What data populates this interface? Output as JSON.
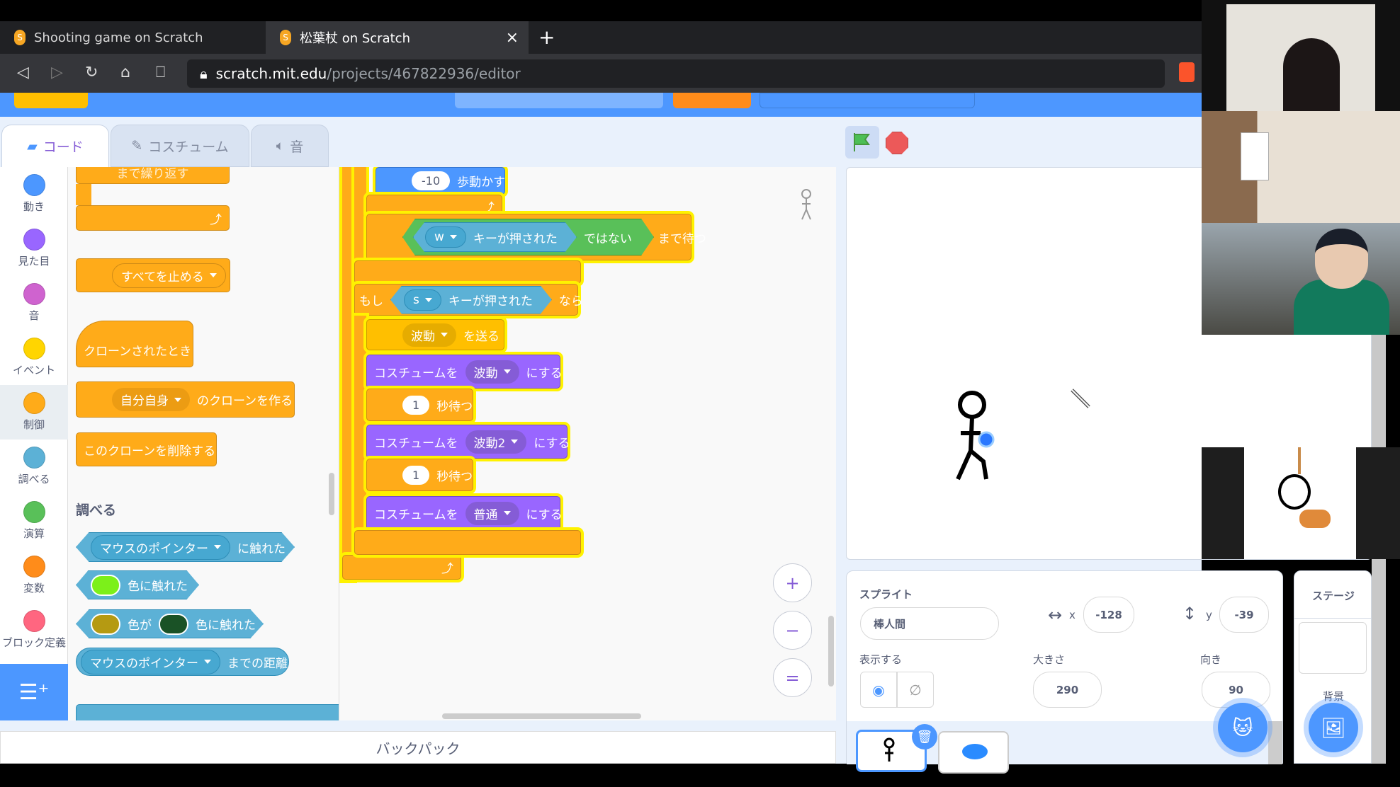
{
  "browser": {
    "tabs": [
      {
        "title": "Shooting game on Scratch",
        "active": false
      },
      {
        "title": "松葉杖 on Scratch",
        "active": true
      }
    ],
    "close_icon": "×",
    "new_tab_icon": "+",
    "url_host": "scratch.mit.edu",
    "url_path": "/projects/467822936/editor"
  },
  "editor": {
    "tabs": [
      {
        "label": "コード",
        "icon": "code-icon"
      },
      {
        "label": "コスチューム",
        "icon": "brush-icon"
      },
      {
        "label": "音",
        "icon": "speaker-icon"
      }
    ],
    "categories": [
      {
        "label": "動き",
        "color": "#4c97ff"
      },
      {
        "label": "見た目",
        "color": "#9966ff"
      },
      {
        "label": "音",
        "color": "#cf63cf"
      },
      {
        "label": "イベント",
        "color": "#ffd500"
      },
      {
        "label": "制御",
        "color": "#ffab19",
        "selected": true
      },
      {
        "label": "調べる",
        "color": "#5cb1d6"
      },
      {
        "label": "演算",
        "color": "#59c059"
      },
      {
        "label": "変数",
        "color": "#ff8c1a"
      },
      {
        "label": "ブロック定義",
        "color": "#ff6680"
      }
    ],
    "palette": {
      "repeat_until": "まで繰り返す",
      "stop_all": "すべてを止める",
      "when_cloned": "クローンされたとき",
      "clone_target": "自分自身",
      "create_clone": "のクローンを作る",
      "delete_clone": "このクローンを削除する",
      "sensing_heading": "調べる",
      "mouse_pointer": "マウスのポインター",
      "touching": "に触れた",
      "touching_color": "色に触れた",
      "color_is": "色が",
      "distance_to": "までの距離",
      "colors": {
        "touch": "#7cf01a",
        "c1": "#b59a12",
        "c2": "#1a5226"
      }
    },
    "script": {
      "move_steps": "-10",
      "move_label": "歩動かす",
      "wait_until": "まで待つ",
      "not_label": "ではない",
      "key_w": "w",
      "key_pressed": "キーが押された",
      "if_label": "もし",
      "then_label": "なら",
      "key_s": "s",
      "broadcast_msg": "波動",
      "broadcast_label": "を送る",
      "costume_label": "コスチュームを",
      "costume_set": "にする",
      "costume1": "波動",
      "costume2": "波動2",
      "costume3": "普通",
      "wait1": "1",
      "wait2": "1",
      "wait_label": "秒待つ"
    },
    "zoom": {
      "in": "+",
      "out": "−",
      "reset": "="
    },
    "backpack": "バックパック"
  },
  "sprite_info": {
    "heading": "スプライト",
    "name": "棒人間",
    "x_label": "x",
    "x": "-128",
    "y_label": "y",
    "y": "-39",
    "show_label": "表示する",
    "size_label": "大きさ",
    "size": "290",
    "direction_label": "向き",
    "direction": "90"
  },
  "stage_panel": {
    "heading": "ステージ",
    "backdrops_label": "背景"
  }
}
